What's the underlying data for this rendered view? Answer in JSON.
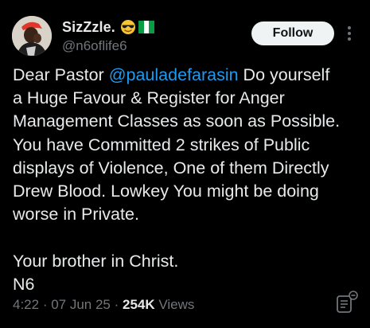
{
  "author": {
    "display_name": "SizZzle.",
    "handle": "@n6oflife6",
    "emoji_1": "sunglasses-face",
    "emoji_2": "nigeria-flag"
  },
  "follow_button": {
    "label": "Follow"
  },
  "more_button": {
    "icon": "more-vertical-icon"
  },
  "tweet": {
    "lines": [
      "Dear Pastor ",
      "a Huge Favour & Register for Anger",
      "Management Classes as soon as Possible.",
      "You have Committed 2 strikes of Public",
      "displays of Violence, One of them Directly",
      "Drew Blood. Lowkey You might be doing",
      "worse in Private.",
      "Your brother in Christ.",
      "N6"
    ],
    "mention": "@pauladefarasin",
    "after_mention": " Do yourself"
  },
  "meta": {
    "time": "4:22",
    "sep1": " · ",
    "date": "07 Jun 25",
    "sep2": " · ",
    "views_count": "254K",
    "views_label": " Views"
  },
  "colors": {
    "background": "#000000",
    "text": "#e7e9ea",
    "secondary": "#71767b",
    "link": "#1d9bf0",
    "button_bg": "#eff3f4"
  },
  "icons": {
    "notes": "community-notes-icon"
  }
}
